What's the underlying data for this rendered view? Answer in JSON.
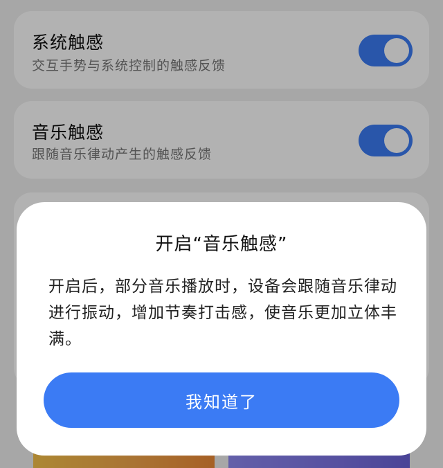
{
  "settings": {
    "system_haptics": {
      "title": "系统触感",
      "subtitle": "交互手势与系统控制的触感反馈",
      "enabled": true
    },
    "music_haptics": {
      "title": "音乐触感",
      "subtitle": "跟随音乐律动产生的触感反馈",
      "enabled": true
    }
  },
  "dialog": {
    "title": "开启“音乐触感”",
    "body": "开启后，部分音乐播放时，设备会跟随音乐律动进行振动，增加节奏打击感，使音乐更加立体丰满。",
    "confirm_label": "我知道了"
  },
  "colors": {
    "accent": "#3b7bf4",
    "background": "#f0f0f0",
    "card": "#ffffff",
    "title_text": "#111111",
    "secondary_text": "#777777",
    "scrim": "rgba(0,0,0,0.30)"
  }
}
